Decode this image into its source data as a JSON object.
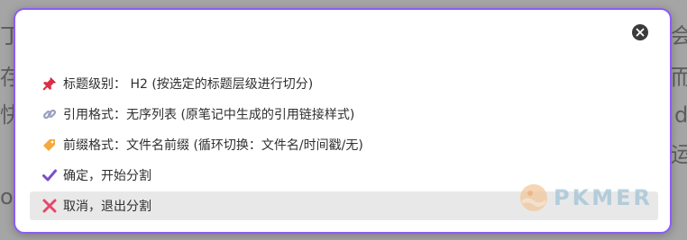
{
  "modal": {
    "options": [
      {
        "icon": "pushpin-icon",
        "label": "标题级别： H2 (按选定的标题层级进行切分)"
      },
      {
        "icon": "link-icon",
        "label": "引用格式：无序列表 (原笔记中生成的引用链接样式)"
      },
      {
        "icon": "tag-icon",
        "label": "前缀格式：文件名前缀 (循环切换：文件名/时间戳/无)"
      },
      {
        "icon": "check-icon",
        "label": "确定，开始分割"
      },
      {
        "icon": "cross-icon",
        "label": "取消，退出分割"
      }
    ],
    "selected_index": 4
  },
  "background": {
    "fragments": [
      "丁",
      "存",
      "快",
      "o",
      "会",
      "而",
      "d",
      "运"
    ]
  },
  "watermark": {
    "text": "PKMER"
  },
  "colors": {
    "accent": "#8b5cf6",
    "selected_bg": "#e8e8e8",
    "close_bg": "#3b3b3b"
  }
}
